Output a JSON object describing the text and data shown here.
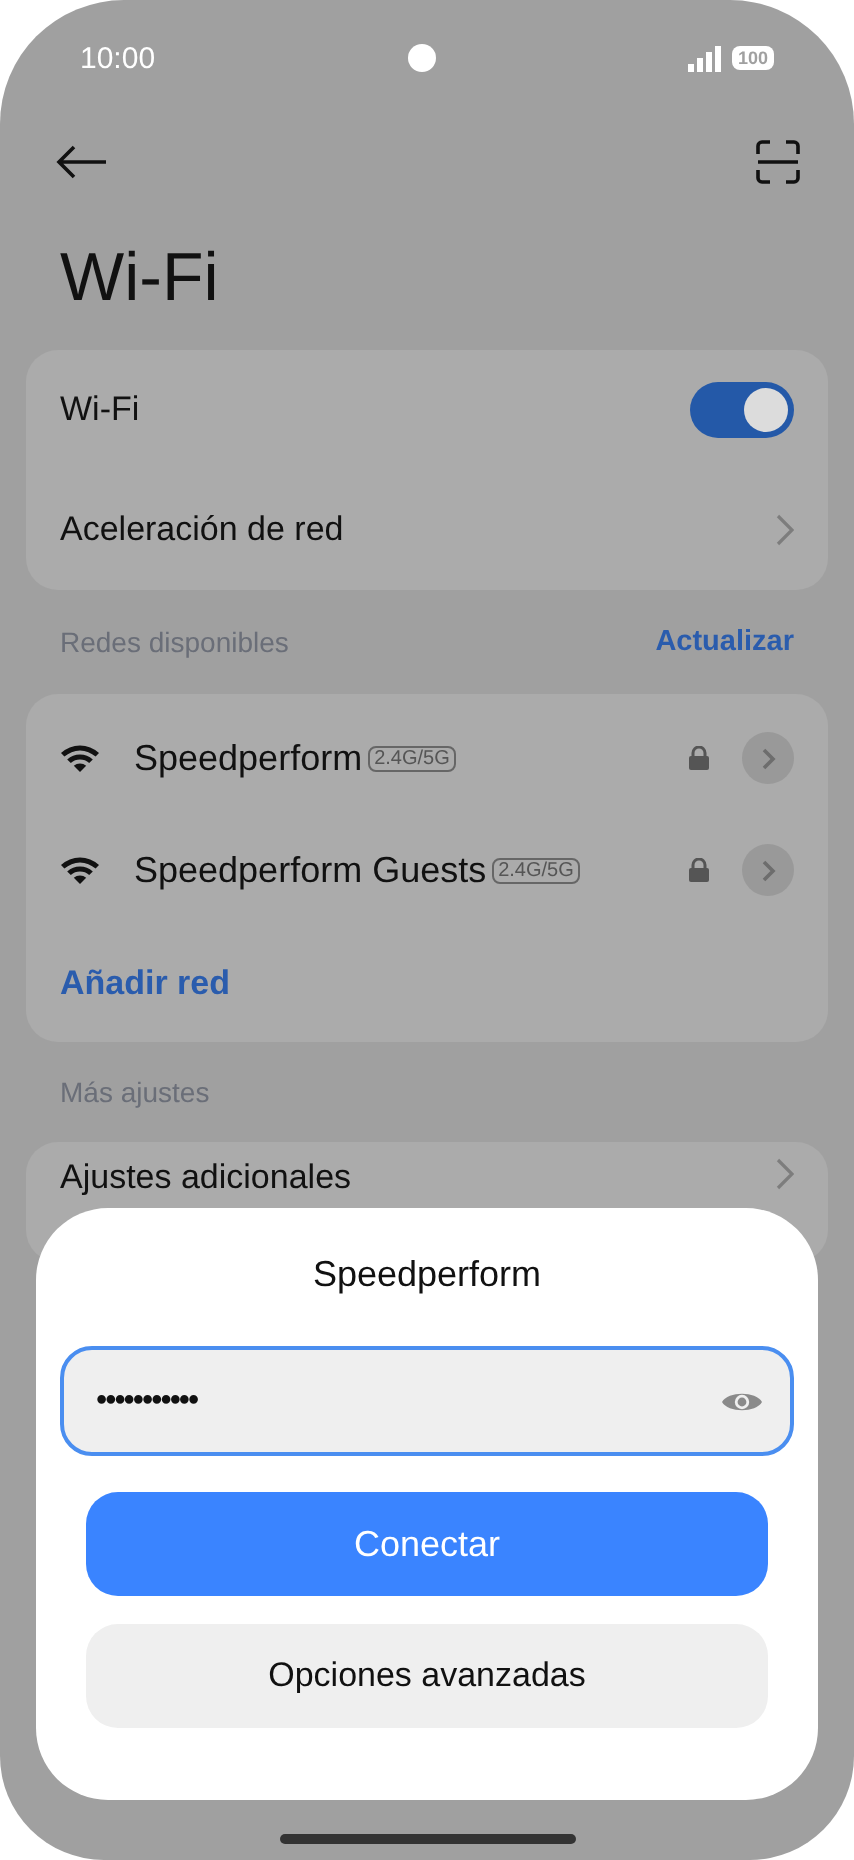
{
  "status_bar": {
    "time": "10:00",
    "battery": "100"
  },
  "header": {
    "title": "Wi-Fi"
  },
  "settings": [
    {
      "kind": "toggle",
      "label": "Wi-Fi",
      "on": true
    },
    {
      "kind": "link",
      "label": "Aceleración de red"
    }
  ],
  "available_networks": {
    "heading": "Redes disponibles",
    "action": "Actualizar",
    "networks": [
      {
        "name": "Speedperform",
        "band": "2.4G/5G",
        "locked": true
      },
      {
        "name": "Speedperform Guests",
        "band": "2.4G/5G",
        "locked": true
      }
    ],
    "add": "Añadir red"
  },
  "more_settings": {
    "heading": "Más ajustes",
    "items": [
      {
        "label": "Ajustes adicionales"
      }
    ]
  },
  "dialog": {
    "title": "Speedperform",
    "password": "•••••••••••",
    "buttons": [
      {
        "label": "Conectar",
        "kind": "primary"
      },
      {
        "label": "Opciones avanzadas",
        "kind": "secondary"
      }
    ]
  }
}
